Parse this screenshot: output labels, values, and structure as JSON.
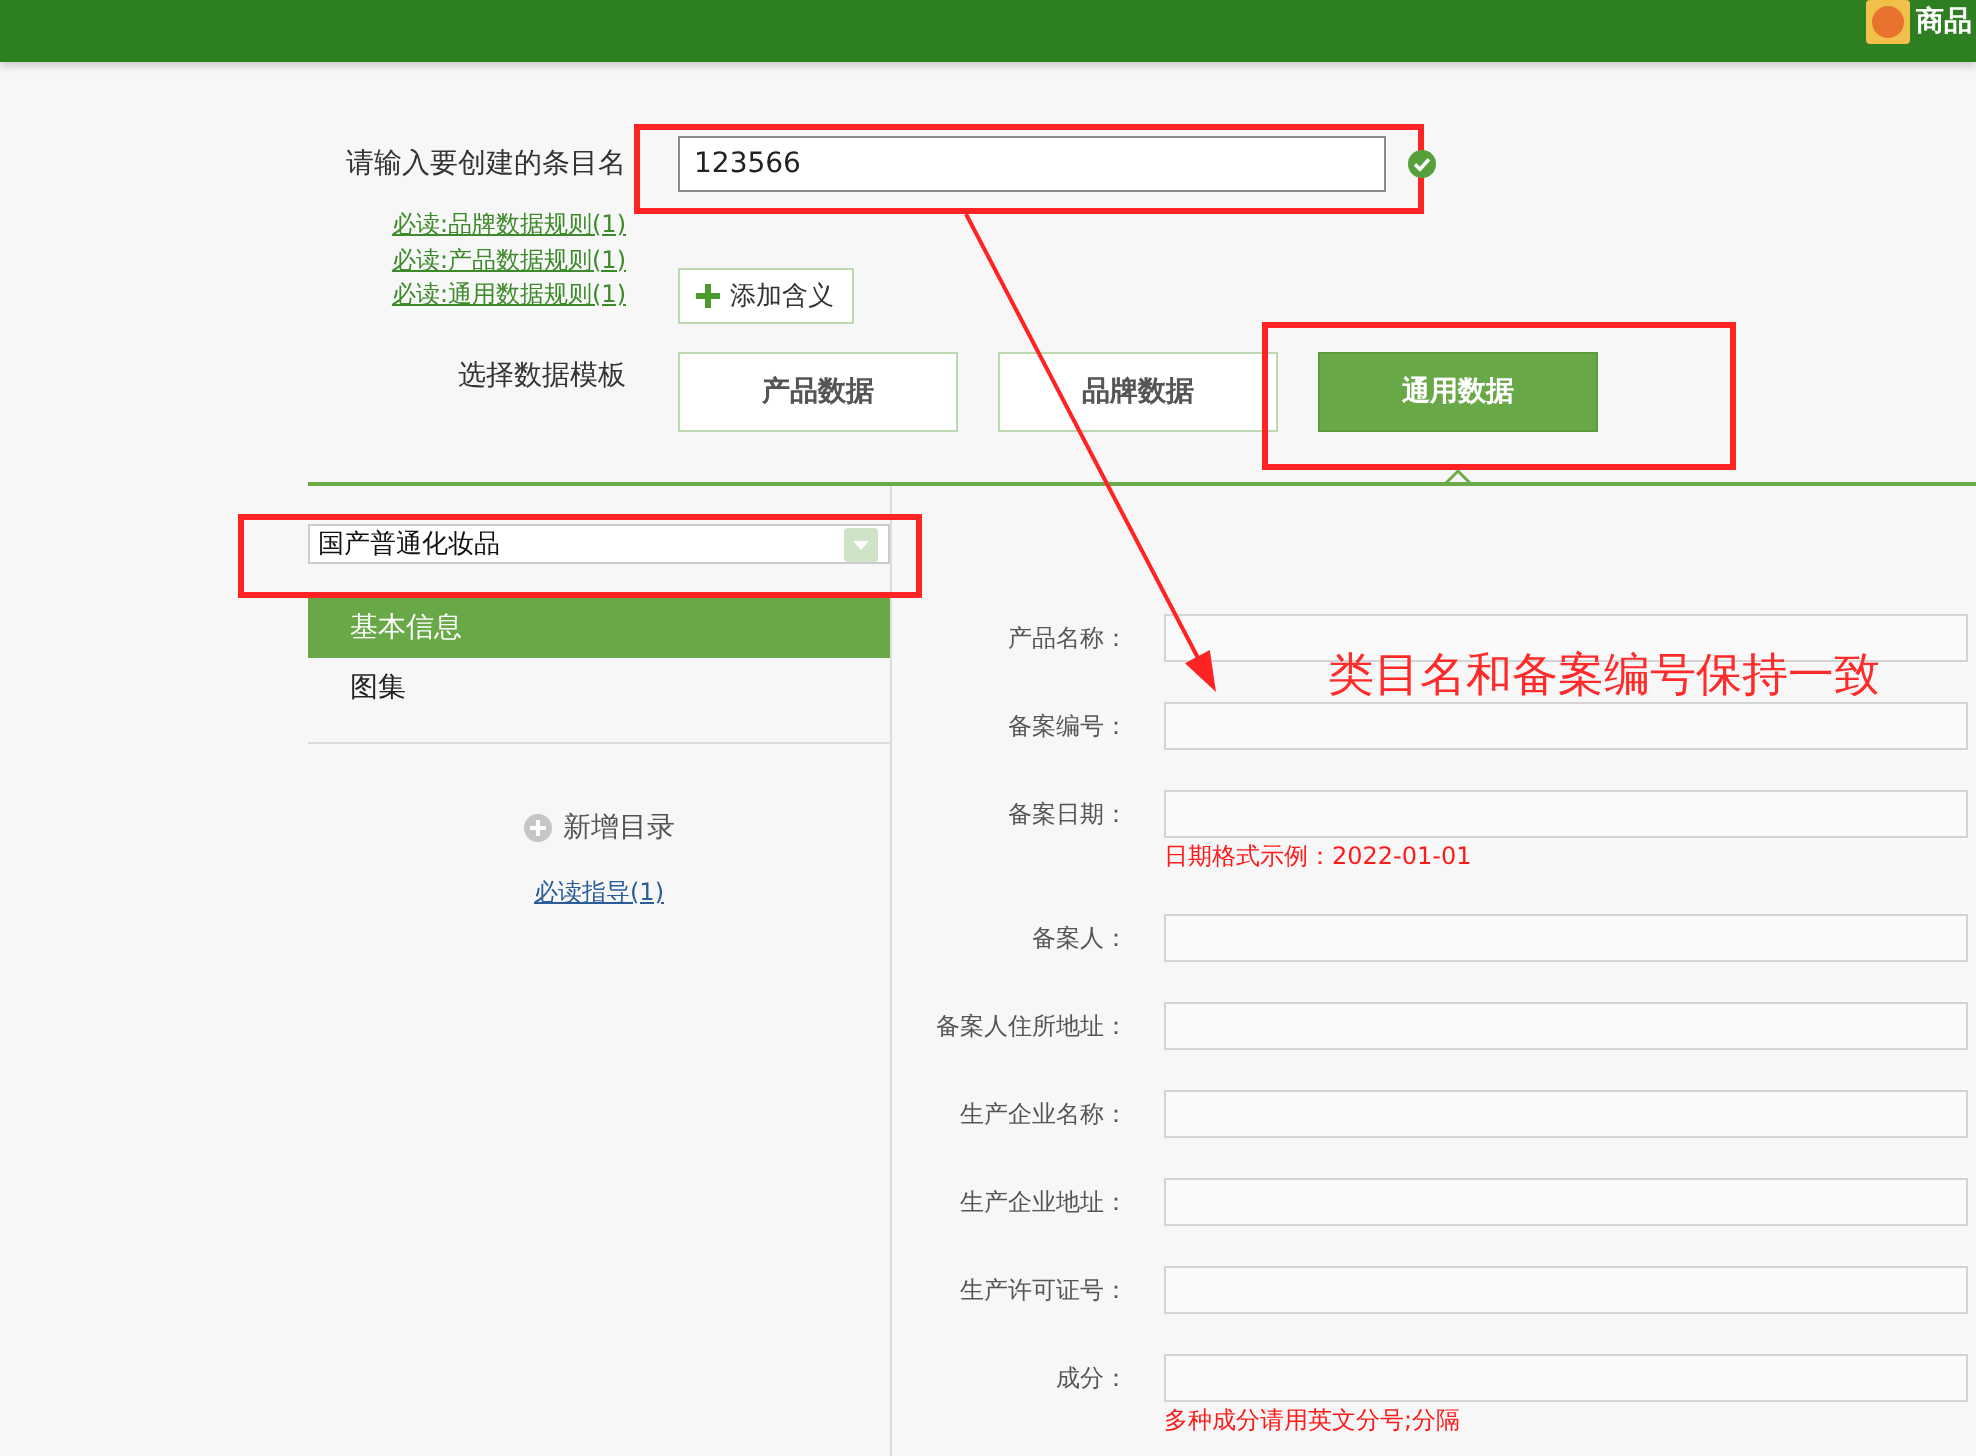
{
  "header": {
    "title": "商品"
  },
  "entry": {
    "label": "请输入要创建的条目名",
    "value": "123566"
  },
  "rule_links": [
    "必读:品牌数据规则(1)",
    "必读:产品数据规则(1)",
    "必读:通用数据规则(1)"
  ],
  "add_button": {
    "label": "添加含义"
  },
  "template": {
    "label": "选择数据模板",
    "options": [
      {
        "label": "产品数据",
        "selected": false
      },
      {
        "label": "品牌数据",
        "selected": false
      },
      {
        "label": "通用数据",
        "selected": true
      }
    ]
  },
  "category_select": {
    "value": "国产普通化妆品"
  },
  "sidebar": {
    "items": [
      {
        "label": "基本信息",
        "selected": true
      },
      {
        "label": "图集",
        "selected": false
      }
    ],
    "add_directory": "新增目录",
    "guide_link": "必读指导(1)"
  },
  "form": {
    "fields": [
      {
        "label": "产品名称："
      },
      {
        "label": "备案编号："
      },
      {
        "label": "备案日期：",
        "hint": "日期格式示例：2022-01-01"
      },
      {
        "label": "备案人："
      },
      {
        "label": "备案人住所地址："
      },
      {
        "label": "生产企业名称："
      },
      {
        "label": "生产企业地址："
      },
      {
        "label": "生产许可证号："
      },
      {
        "label": "成分：",
        "hint": "多种成分请用英文分号;分隔"
      }
    ]
  },
  "annotation": {
    "note": "类目名和备案编号保持一致"
  }
}
